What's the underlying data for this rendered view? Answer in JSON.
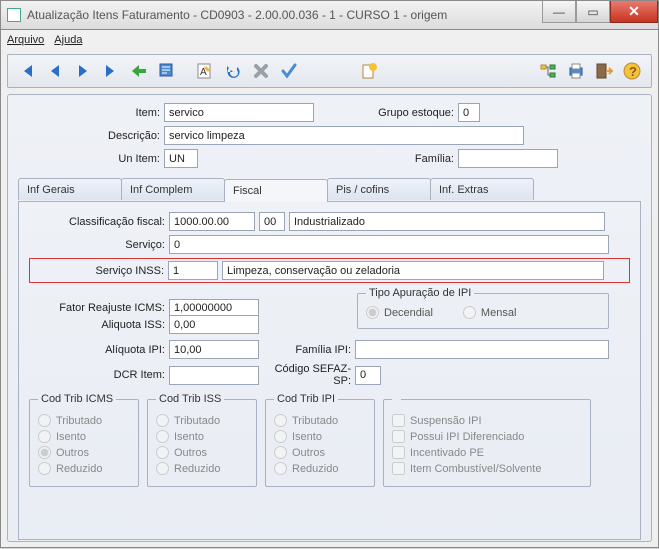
{
  "window": {
    "title": "Atualização Itens Faturamento - CD0903 - 2.00.00.036 - 1 - CURSO 1 - origem"
  },
  "menu": {
    "arquivo": "Arquivo",
    "ajuda": "Ajuda"
  },
  "header": {
    "item_lbl": "Item:",
    "item_val": "servico",
    "grupo_lbl": "Grupo estoque:",
    "grupo_val": "0",
    "desc_lbl": "Descrição:",
    "desc_val": "servico limpeza",
    "un_lbl": "Un Item:",
    "un_val": "UN",
    "familia_lbl": "Família:",
    "familia_val": ""
  },
  "tabs": {
    "t1": "Inf Gerais",
    "t2": "Inf Complem",
    "t3": "Fiscal",
    "t4": "Pis / cofins",
    "t5": "Inf. Extras"
  },
  "fiscal": {
    "class_lbl": "Classificação fiscal:",
    "class_val": "1000.00.00",
    "class_cod": "00",
    "class_desc": "Industrializado",
    "servico_lbl": "Serviço:",
    "servico_val": "0",
    "inss_lbl": "Serviço INSS:",
    "inss_val": "1",
    "inss_desc": "Limpeza, conservação ou zeladoria",
    "fator_lbl": "Fator Reajuste ICMS:",
    "fator_val": "1,00000000",
    "ipi_group": "Tipo Apuração de IPI",
    "ipi_dec": "Decendial",
    "ipi_men": "Mensal",
    "iss_lbl": "Aliquota ISS:",
    "iss_val": "0,00",
    "alipi_lbl": "Alíquota IPI:",
    "alipi_val": "10,00",
    "famipi_lbl": "Família IPI:",
    "famipi_val": "",
    "dcr_lbl": "DCR Item:",
    "dcr_val": "",
    "sefaz_lbl": "Código SEFAZ-SP:",
    "sefaz_val": "0",
    "cod_icms": "Cod Trib ICMS",
    "cod_iss": "Cod Trib ISS",
    "cod_ipi": "Cod Trib IPI",
    "opt_trib": "Tributado",
    "opt_isento": "Isento",
    "opt_outros": "Outros",
    "opt_reduz": "Reduzido",
    "chk_susp": "Suspensão IPI",
    "chk_dif": "Possui IPI Diferenciado",
    "chk_inc": "Incentivado PE",
    "chk_comb": "Item Combustível/Solvente"
  }
}
